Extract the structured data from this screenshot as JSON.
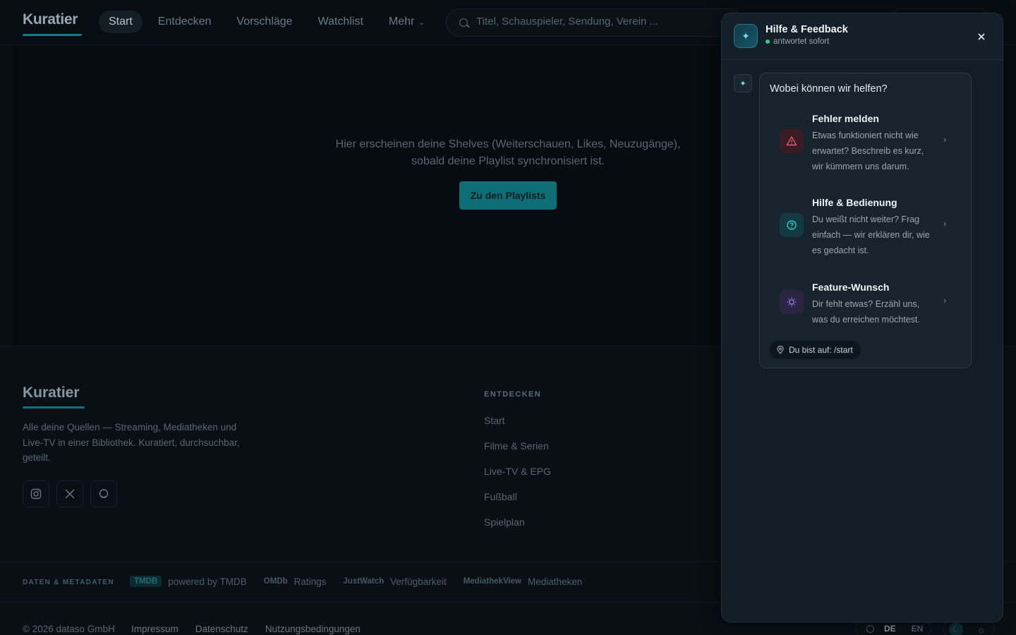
{
  "header": {
    "logo": "Kuratier",
    "nav": [
      {
        "label": "Start",
        "active": true
      },
      {
        "label": "Entdecken"
      },
      {
        "label": "Vorschläge"
      },
      {
        "label": "Watchlist"
      },
      {
        "label": "Mehr"
      }
    ],
    "search_placeholder": "Titel, Schauspieler, Sendung, Verein ..."
  },
  "main": {
    "empty_message": "Hier erscheinen deine Shelves (Weiterschauen, Likes, Neuzugänge), sobald deine Playlist synchronisiert ist.",
    "cta_label": "Zu den Playlists"
  },
  "footer": {
    "logo": "Kuratier",
    "description": "Alle deine Quellen — Streaming, Mediatheken und Live-TV in einer Bibliothek. Kuratiert, durchsuchbar, geteilt.",
    "social": [
      "instagram-icon",
      "x-icon",
      "github-icon"
    ],
    "column_title": "ENTDECKEN",
    "links": [
      "Start",
      "Filme & Serien",
      "Live-TV & EPG",
      "Fußball",
      "Spielplan"
    ],
    "meta_label": "DATEN & METADATEN",
    "meta": [
      {
        "brand": "TMDB",
        "text": "powered by TMDB"
      },
      {
        "brand": "OMDb",
        "text": "Ratings"
      },
      {
        "brand": "JustWatch",
        "text": "Verfügbarkeit"
      },
      {
        "brand": "MediathekView",
        "text": "Mediatheken"
      }
    ],
    "copyright": "© 2026 dataso GmbH",
    "legal": [
      "Impressum",
      "Datenschutz",
      "Nutzungsbedingungen"
    ],
    "languages": [
      "DE",
      "EN"
    ]
  },
  "help_panel": {
    "title": "Hilfe & Feedback",
    "status": "antwortet sofort",
    "question": "Wobei können wir helfen?",
    "options": [
      {
        "title": "Fehler melden",
        "description": "Etwas funktioniert nicht wie erwartet? Beschreib es kurz, wir kümmern uns darum.",
        "icon": "warning-icon"
      },
      {
        "title": "Hilfe & Bedienung",
        "description": "Du weißt nicht weiter? Frag einfach — wir erklären dir, wie es gedacht ist.",
        "icon": "question-icon"
      },
      {
        "title": "Feature-Wunsch",
        "description": "Dir fehlt etwas? Erzähl uns, was du erreichen möchtest.",
        "icon": "lightbulb-icon"
      }
    ],
    "location": "Du bist auf: /start"
  },
  "colors": {
    "accent": "#0f6e75",
    "status_online": "#34c98a",
    "panel_bg": "#121d26"
  }
}
